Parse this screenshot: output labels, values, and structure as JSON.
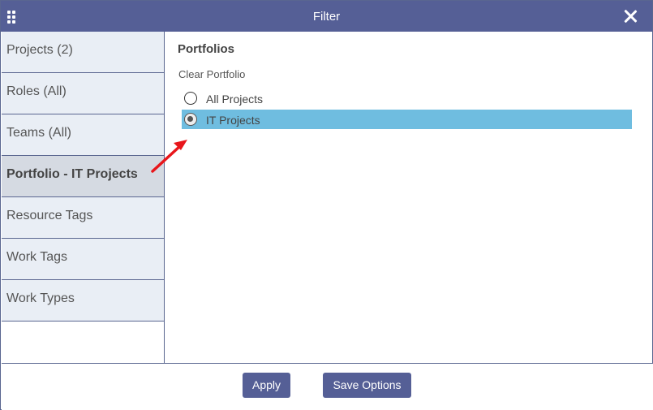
{
  "window": {
    "title": "Filter"
  },
  "sidebar": {
    "items": [
      {
        "label": "Projects (2)",
        "active": false
      },
      {
        "label": "Roles (All)",
        "active": false
      },
      {
        "label": "Teams (All)",
        "active": false
      },
      {
        "label": "Portfolio - IT Projects",
        "active": true
      },
      {
        "label": "Resource Tags",
        "active": false
      },
      {
        "label": "Work Tags",
        "active": false
      },
      {
        "label": "Work Types",
        "active": false
      }
    ]
  },
  "main": {
    "section_title": "Portfolios",
    "clear_label": "Clear Portfolio",
    "options": [
      {
        "label": "All Projects",
        "selected": false
      },
      {
        "label": "IT Projects",
        "selected": true
      }
    ]
  },
  "footer": {
    "apply_label": "Apply",
    "save_label": "Save Options"
  },
  "colors": {
    "titlebar": "#555f96",
    "selected_row": "#6fbde0",
    "sidebar_bg": "#e9eef5",
    "sidebar_active_bg": "#d5dae2",
    "annotation_arrow": "#e8161b"
  }
}
